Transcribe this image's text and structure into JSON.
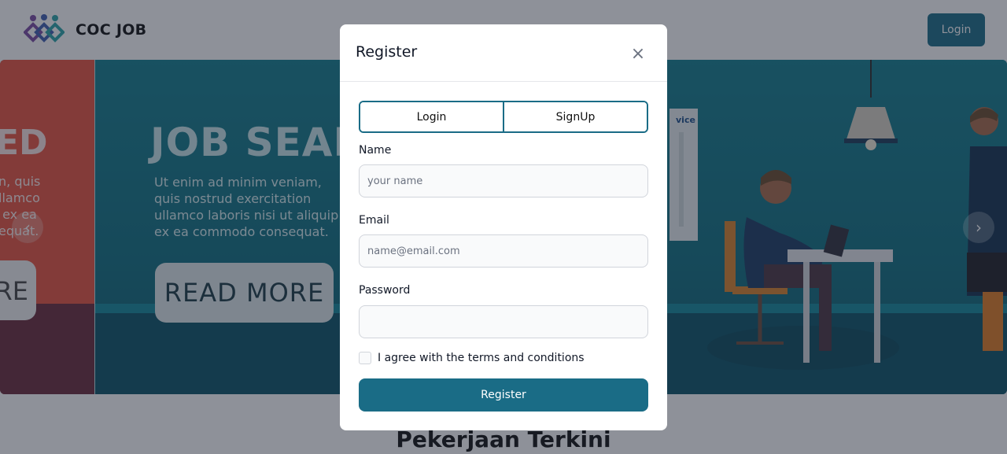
{
  "navbar": {
    "brand": "COC JOB",
    "login_label": "Login"
  },
  "carousel": {
    "prev_slide": {
      "title_fragment": "ED",
      "text_fragment": "n, quis\nllamco\n ex ea\nequat.",
      "button_fragment": "RE"
    },
    "current_slide": {
      "title": "JOB SEARCH",
      "text": "Ut enim ad minim veniam, quis nostrud exercitation ullamco laboris nisi ut aliquip ex ea commodo consequat.",
      "button_label": "READ MORE",
      "sign_text": "vice"
    },
    "prev_arrow": "‹",
    "next_arrow": "›"
  },
  "section": {
    "title": "Pekerjaan Terkini"
  },
  "modal": {
    "title": "Register",
    "close_icon": "×",
    "tabs": [
      {
        "label": "Login"
      },
      {
        "label": "SignUp"
      }
    ],
    "fields": {
      "name": {
        "label": "Name",
        "placeholder": "your name",
        "value": ""
      },
      "email": {
        "label": "Email",
        "placeholder": "name@email.com",
        "value": ""
      },
      "password": {
        "label": "Password",
        "placeholder": "",
        "value": ""
      }
    },
    "terms_label": "I agree with the terms and conditions",
    "terms_checked": false,
    "submit_label": "Register"
  },
  "colors": {
    "primary": "#1a6c86",
    "hero_teal": "#0f7d8c",
    "prev_slide_red": "#e8533f"
  }
}
